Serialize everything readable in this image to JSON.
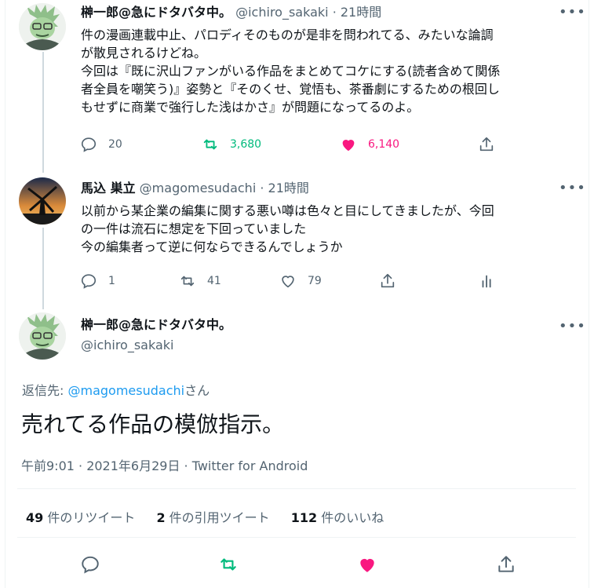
{
  "colors": {
    "accent": "#1d9bf0",
    "retweet_active": "#00ba7c",
    "like_active": "#f91880",
    "muted": "#536471",
    "text": "#0f1419"
  },
  "tweet1": {
    "name": "榊一郎@急にドタバタ中。",
    "handle": "@ichiro_sakaki",
    "time": "· 21時間",
    "more_icon": "more-icon",
    "text": "件の漫画連載中止、パロディそのものが是非を問われてる、みたいな論調\nが散見されるけどね。\n今回は『既に沢山ファンがいる作品をまとめてコケにする(読者含めて関係\n者全員を嘲笑う)』姿勢と『そのくせ、覚悟も、茶番劇にするための根回し\nもせずに商業で強行した浅はかさ』が問題になってるのよ。",
    "reply_count": "20",
    "retweet_count": "3,680",
    "like_count": "6,140"
  },
  "tweet2": {
    "name": "馬込 巣立",
    "handle": "@magomesudachi",
    "time": "· 21時間",
    "text": "以前から某企業の編集に関する悪い噂は色々と目にしてきましたが、今回\nの一件は流石に想定を下回っていました\n今の編集者って逆に何ならできるんでしょうか",
    "reply_count": "1",
    "retweet_count": "41",
    "like_count": "79"
  },
  "main_tweet": {
    "name": "榊一郎@急にドタバタ中。",
    "handle": "@ichiro_sakaki",
    "reply_to_prefix": "返信先: ",
    "reply_to_handle": "@magomesudachi",
    "reply_to_suffix": "さん",
    "text": "売れてる作品の模倣指示。",
    "timestamp": "午前9:01 · 2021年6月29日 · Twitter for Android",
    "retweets_num": "49",
    "retweets_label": " 件のリツイート",
    "quotes_num": "2",
    "quotes_label": " 件の引用ツイート",
    "likes_num": "112",
    "likes_label": " 件のいいね"
  }
}
